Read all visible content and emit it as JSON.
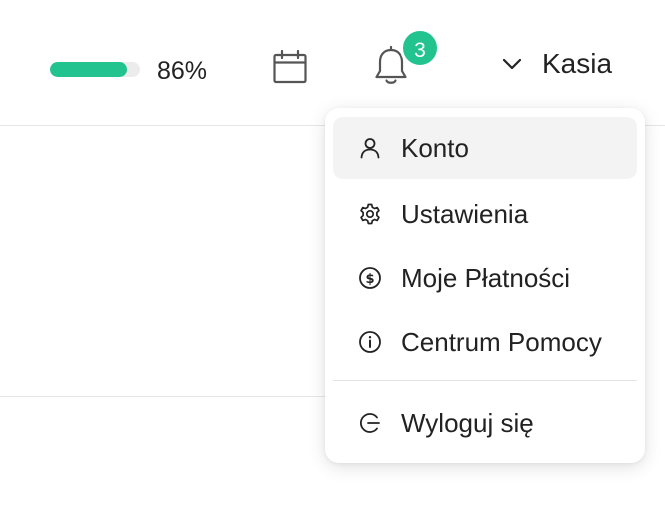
{
  "header": {
    "progress_percent": 86,
    "progress_label": "86%",
    "notification_count": "3",
    "user_name": "Kasia"
  },
  "dropdown": {
    "items": [
      {
        "label": "Konto",
        "icon": "user-icon"
      },
      {
        "label": "Ustawienia",
        "icon": "gear-icon"
      },
      {
        "label": "Moje Płatności",
        "icon": "dollar-circle-icon"
      },
      {
        "label": "Centrum Pomocy",
        "icon": "info-circle-icon"
      }
    ],
    "logout_label": "Wyloguj się"
  },
  "colors": {
    "accent": "#22c38e"
  }
}
